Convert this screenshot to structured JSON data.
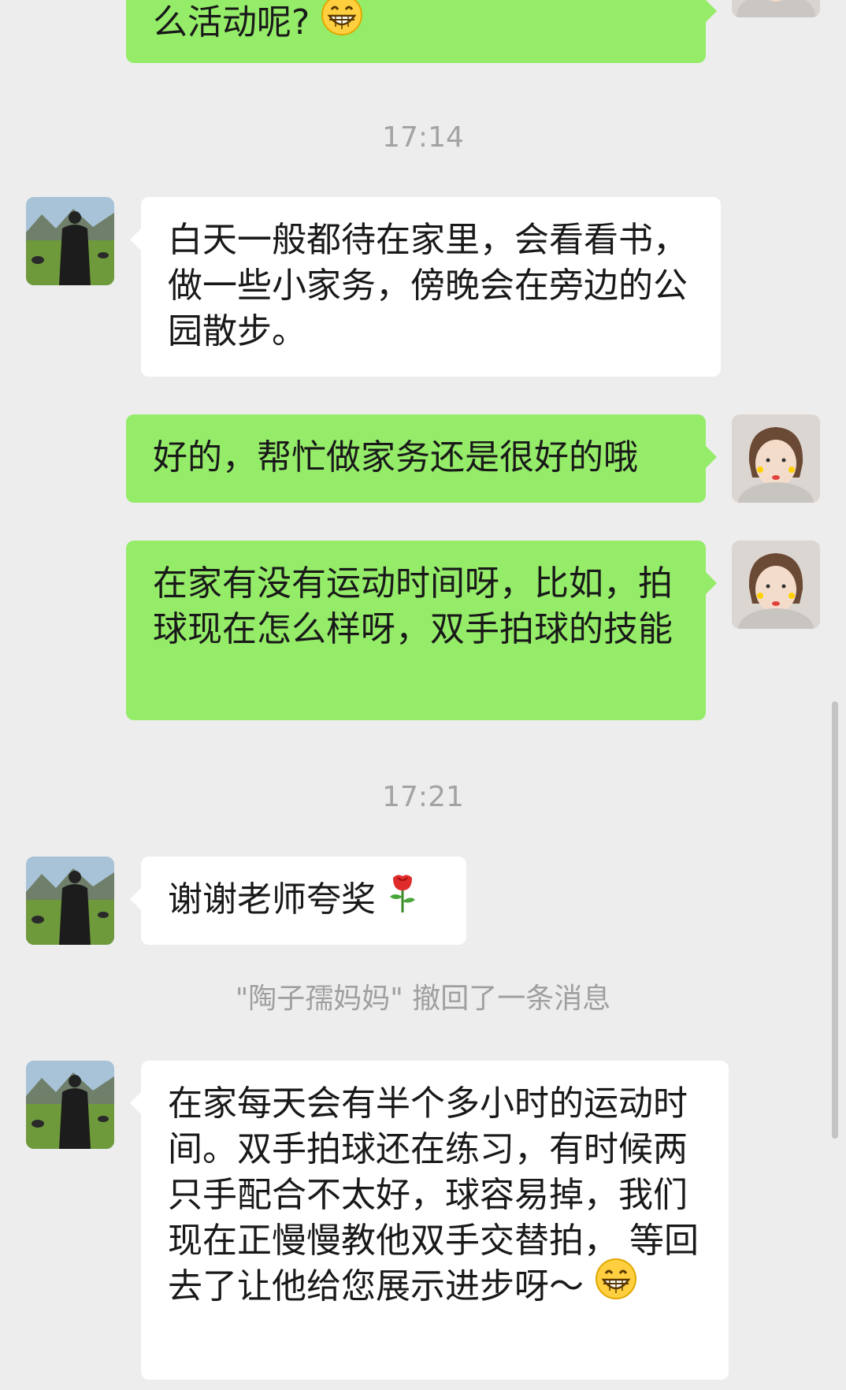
{
  "messages": {
    "m0_text": "么活动呢?",
    "ts1": "17:14",
    "m1_text": "白天一般都待在家里，会看看书，做一些小家务，傍晚会在旁边的公园散步。",
    "m2_text": "好的，帮忙做家务还是很好的哦",
    "m3_text": "在家有没有运动时间呀，比如，拍球现在怎么样呀，双手拍球的技能",
    "ts2": "17:21",
    "m4_text": "谢谢老师夸奖",
    "recall_notice": "\"陶子孺妈妈\" 撤回了一条消息",
    "m5_text": "在家每天会有半个多小时的运动时间。双手拍球还在练习，有时候两只手配合不太好，球容易掉，我们现在正慢慢教他双手交替拍， 等回去了让他给您展示进步呀～"
  },
  "icons": {
    "grin": "grinning-face-emoji",
    "rose": "rose-emoji",
    "contact_avatar": "contact-avatar-man-in-field",
    "self_avatar": "self-avatar-woman-photo"
  },
  "colors": {
    "background": "#ededed",
    "sent_bubble": "#95ec69",
    "received_bubble": "#ffffff",
    "timestamp": "#a3a3a3"
  }
}
